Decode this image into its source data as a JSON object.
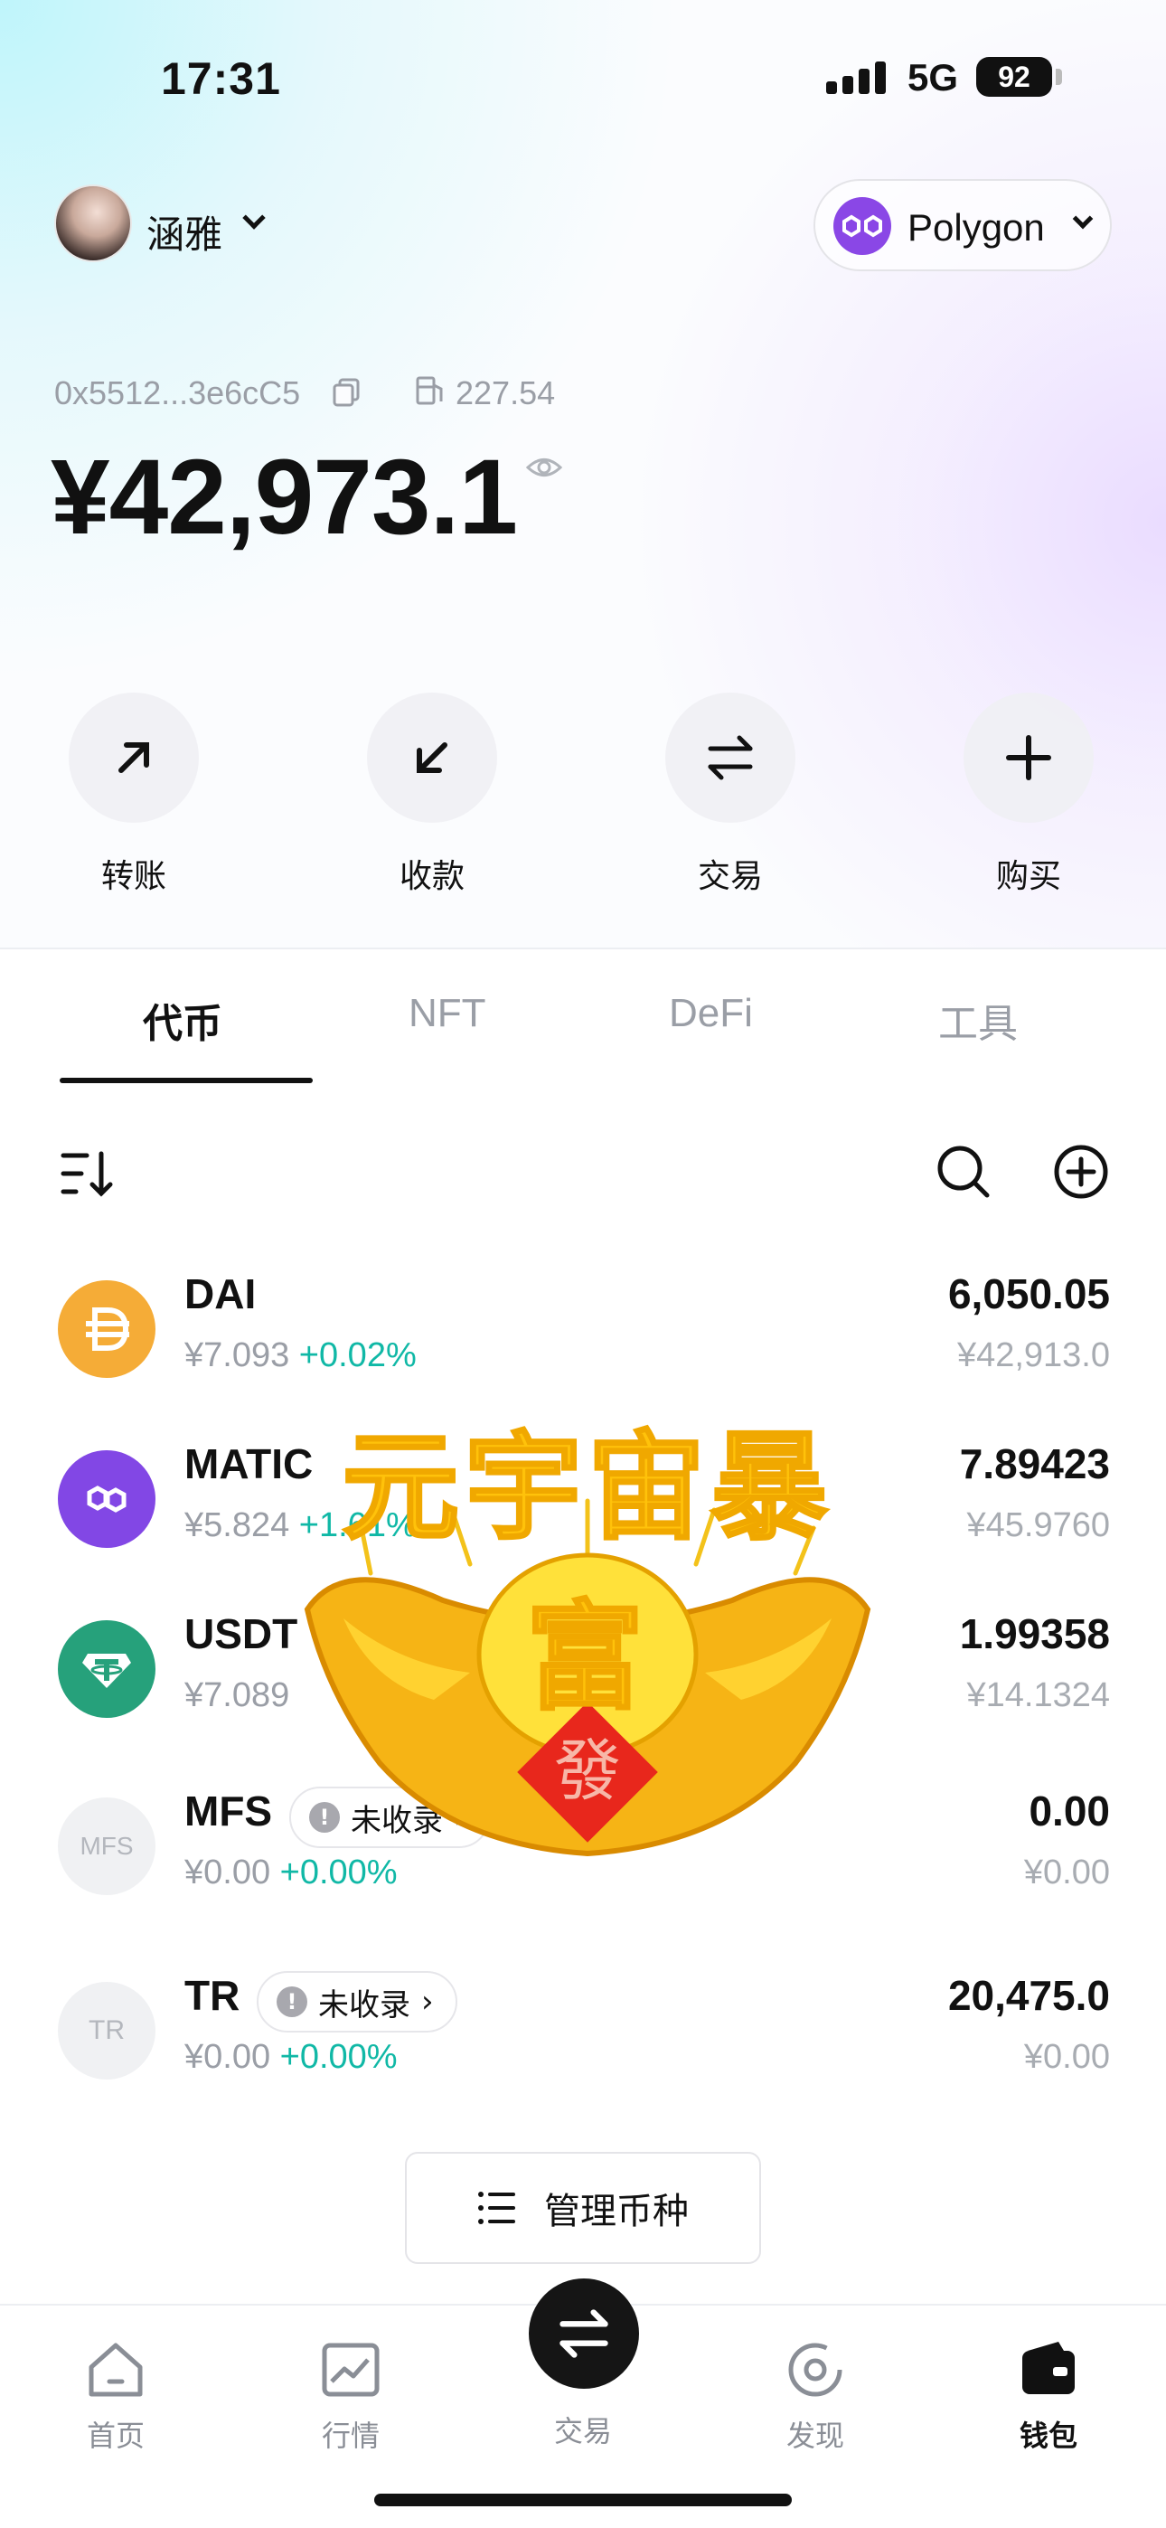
{
  "status_bar": {
    "time": "17:31",
    "network": "5G",
    "battery": "92"
  },
  "header": {
    "username": "涵雅",
    "network_selector": "Polygon"
  },
  "wallet": {
    "address": "0x5512...3e6cC5",
    "gas": "227.54",
    "balance": "¥42,973.1"
  },
  "actions": [
    {
      "label": "转账",
      "icon": "arrow-up-right-icon"
    },
    {
      "label": "收款",
      "icon": "arrow-down-left-icon"
    },
    {
      "label": "交易",
      "icon": "swap-icon"
    },
    {
      "label": "购买",
      "icon": "plus-icon"
    }
  ],
  "tabs": [
    {
      "label": "代币",
      "active": true
    },
    {
      "label": "NFT",
      "active": false
    },
    {
      "label": "DeFi",
      "active": false
    },
    {
      "label": "工具",
      "active": false
    }
  ],
  "tokens": [
    {
      "symbol": "DAI",
      "price": "¥7.093",
      "change": "+0.02%",
      "amount": "6,050.05",
      "value": "¥42,913.0",
      "color": "#f5ac37"
    },
    {
      "symbol": "MATIC",
      "price": "¥5.824",
      "change": "+1.61%",
      "amount": "7.89423",
      "value": "¥45.9760",
      "color": "#8247e5"
    },
    {
      "symbol": "USDT",
      "price": "¥7.089",
      "change": "",
      "amount": "1.99358",
      "value": "¥14.1324",
      "color": "#26a17b"
    },
    {
      "symbol": "MFS",
      "icon_text": "MFS",
      "badge": "未收录",
      "price": "¥0.00",
      "change": "+0.00%",
      "amount": "0.00",
      "value": "¥0.00",
      "color": "#f0f1f3"
    },
    {
      "symbol": "TR",
      "icon_text": "TR",
      "badge": "未收录",
      "price": "¥0.00",
      "change": "+0.00%",
      "amount": "20,475.0",
      "value": "¥0.00",
      "color": "#f0f1f3"
    }
  ],
  "manage_button": "管理币种",
  "sticker": {
    "text": "元宇宙暴富",
    "stamp": "發"
  },
  "bottom_nav": [
    {
      "label": "首页",
      "icon": "home-icon"
    },
    {
      "label": "行情",
      "icon": "chart-icon"
    },
    {
      "label": "交易",
      "icon": "swap-icon"
    },
    {
      "label": "发现",
      "icon": "discover-icon"
    },
    {
      "label": "钱包",
      "icon": "wallet-icon",
      "active": true
    }
  ]
}
